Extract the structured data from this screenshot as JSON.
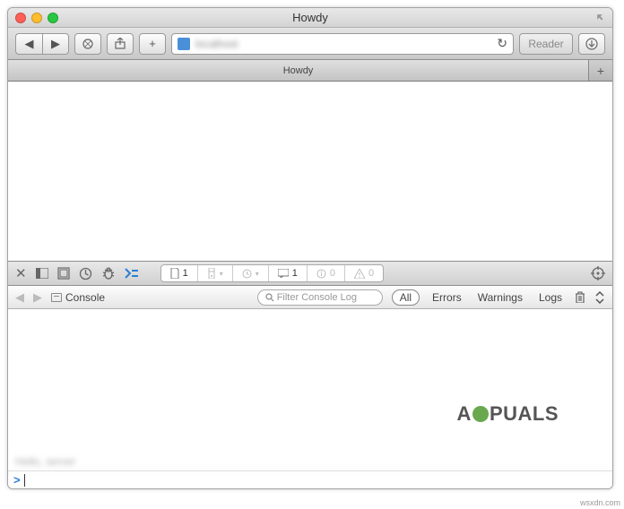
{
  "window": {
    "title": "Howdy"
  },
  "toolbar": {
    "address_text": "localhost",
    "reader_label": "Reader"
  },
  "tabbar": {
    "tabs": [
      {
        "label": "Howdy"
      }
    ]
  },
  "devtools": {
    "filter_pills": {
      "documents": {
        "count": "1"
      },
      "stylesheets": {
        "count": ""
      },
      "time": {
        "count": ""
      },
      "logs": {
        "count": "1"
      },
      "issues": {
        "count": "0"
      },
      "warnings": {
        "count": "0"
      }
    },
    "console": {
      "breadcrumb": "Console",
      "search_placeholder": "Filter Console Log",
      "tabs": {
        "all": "All",
        "errors": "Errors",
        "warnings": "Warnings",
        "logs": "Logs"
      },
      "prompt": ">",
      "blurred_output": "Hello, server"
    }
  },
  "watermark": {
    "prefix": "A",
    "suffix": "PUALS"
  },
  "attribution": "wsxdn.com"
}
